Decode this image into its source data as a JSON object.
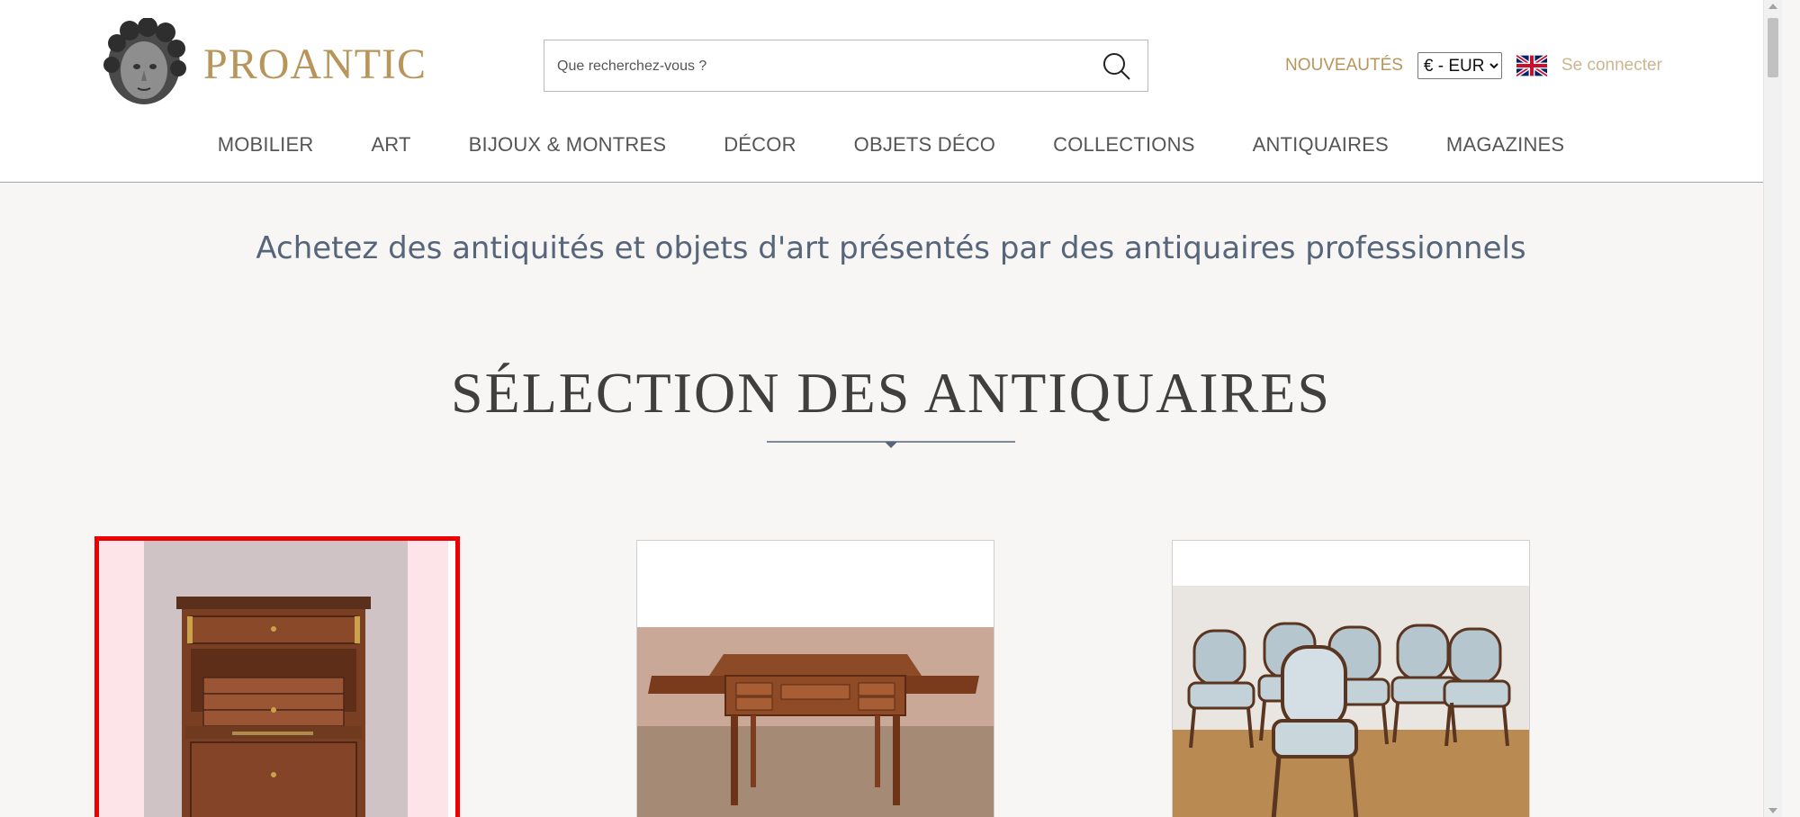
{
  "header": {
    "logo_text": "PROANTIC",
    "search": {
      "placeholder": "Que recherchez-vous ?"
    },
    "new_link": "NOUVEAUTÉS",
    "currency": {
      "selected": "€ - EUR"
    },
    "language_flag": "uk-flag-icon",
    "login_link": "Se connecter"
  },
  "nav": {
    "items": [
      "MOBILIER",
      "ART",
      "BIJOUX & MONTRES",
      "DÉCOR",
      "OBJETS DÉCO",
      "COLLECTIONS",
      "ANTIQUAIRES",
      "MAGAZINES"
    ]
  },
  "main": {
    "tagline": "Achetez des antiquités et objets d'art présentés par des antiquaires professionnels",
    "section_title": "SÉLECTION DES ANTIQUAIRES"
  },
  "colors": {
    "brand_gold": "#b8955a",
    "tagline_blue": "#56657a",
    "selection_red": "#ee0000",
    "page_background": "#f7f6f4"
  }
}
